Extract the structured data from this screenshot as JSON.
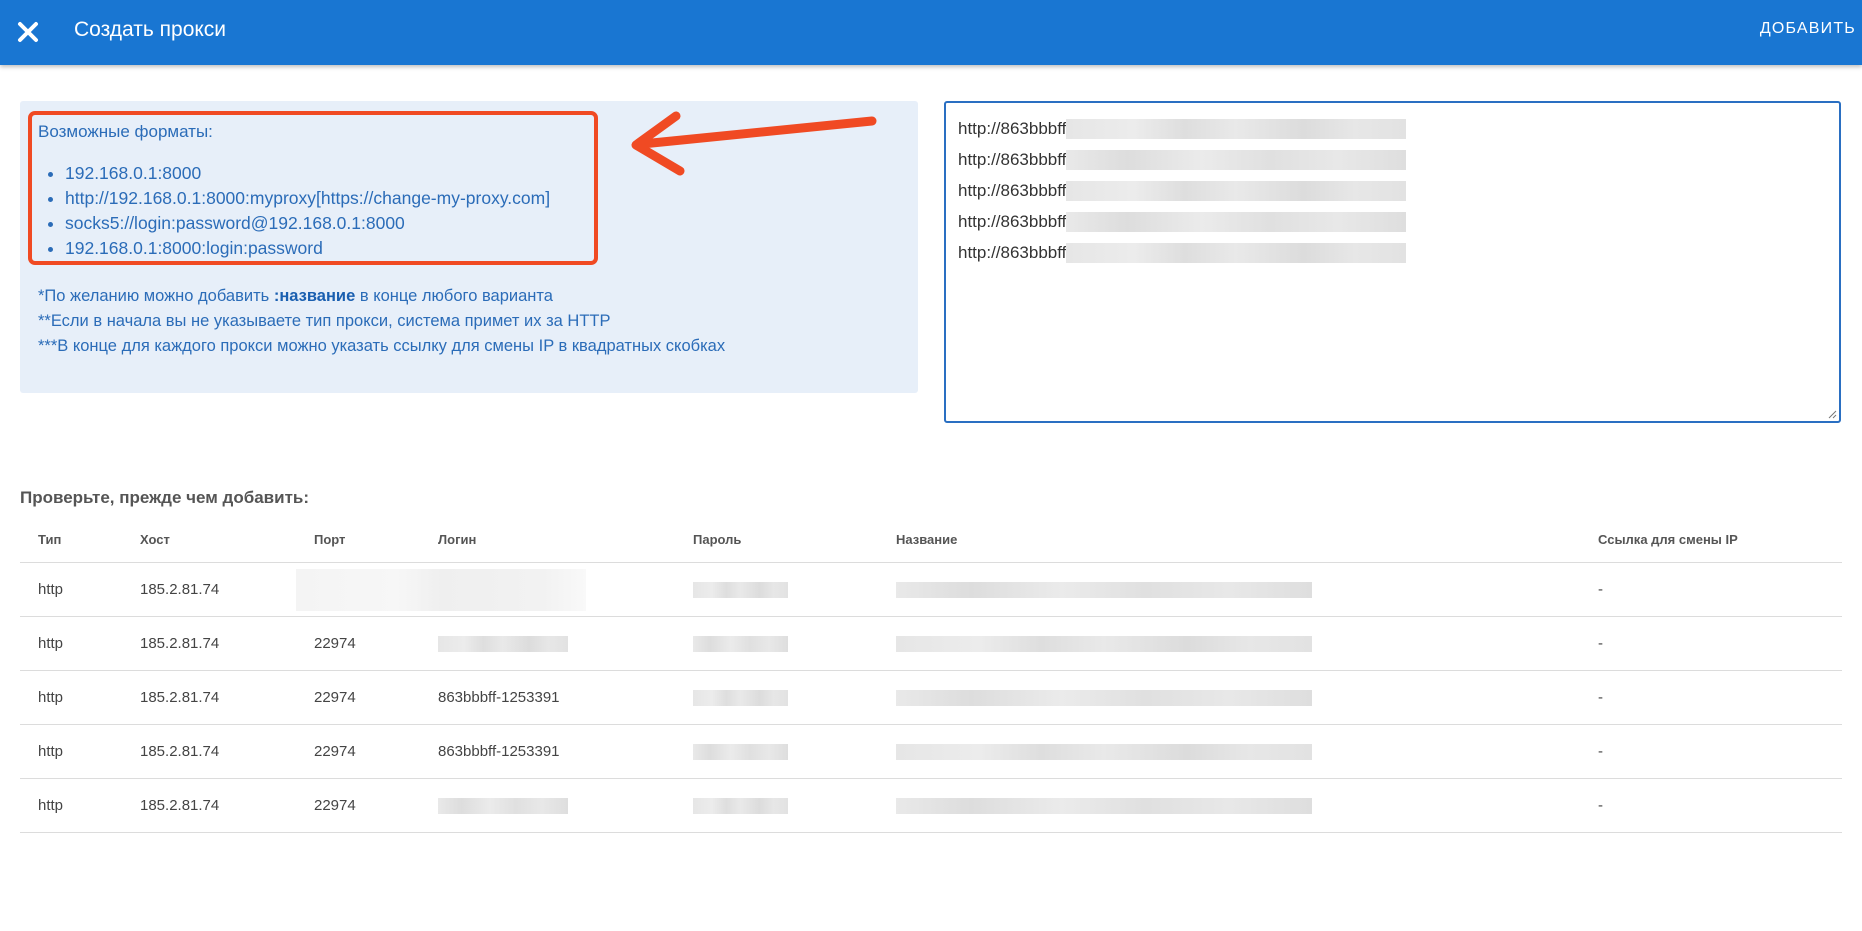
{
  "header": {
    "title": "Создать прокси",
    "add_label": "ДОБАВИТЬ"
  },
  "info": {
    "formats_title": "Возможные форматы:",
    "formats": [
      "192.168.0.1:8000",
      "http://192.168.0.1:8000:myproxy[https://change-my-proxy.com]",
      "socks5://login:password@192.168.0.1:8000",
      "192.168.0.1:8000:login:password"
    ],
    "note1_prefix": "*По желанию можно добавить ",
    "note1_bold": ":название",
    "note1_suffix": " в конце любого варианта",
    "note2": "**Если в начала вы не указываете тип прокси, система примет их за HTTP",
    "note3": "***В конце для каждого прокси можно указать ссылку для смены IP в квадратных скобках"
  },
  "textarea": {
    "lines": [
      "http://863bbbff",
      "http://863bbbff",
      "http://863bbbff",
      "http://863bbbff",
      "http://863bbbff"
    ]
  },
  "preview": {
    "title": "Проверьте, прежде чем добавить:",
    "columns": [
      "Тип",
      "Хост",
      "Порт",
      "Логин",
      "Пароль",
      "Название",
      "Ссылка для смены IP"
    ],
    "rows": [
      {
        "type": "http",
        "host": "185.2.81.74",
        "port": "",
        "login": "",
        "link": "-"
      },
      {
        "type": "http",
        "host": "185.2.81.74",
        "port": "22974",
        "login": "",
        "link": "-"
      },
      {
        "type": "http",
        "host": "185.2.81.74",
        "port": "22974",
        "login": "863bbbff-1253391",
        "link": "-"
      },
      {
        "type": "http",
        "host": "185.2.81.74",
        "port": "22974",
        "login": "863bbbff-1253391",
        "link": "-"
      },
      {
        "type": "http",
        "host": "185.2.81.74",
        "port": "22974",
        "login": "",
        "link": "-"
      }
    ]
  },
  "colors": {
    "header_bg": "#1976d2",
    "info_bg": "#e7eff9",
    "info_text": "#2b6cb8",
    "highlight": "#f04a23"
  }
}
